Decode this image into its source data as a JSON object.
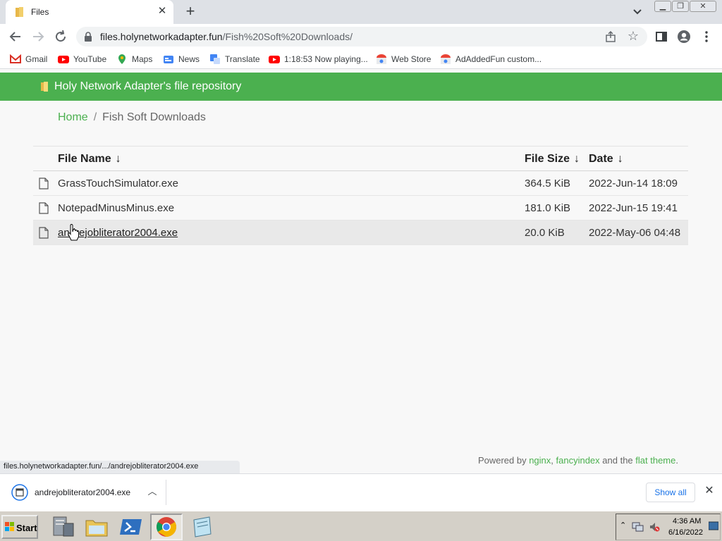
{
  "browser": {
    "tab": {
      "title": "Files"
    },
    "address": {
      "domain": "files.holynetworkadapter.fun",
      "path": "/Fish%20Soft%20Downloads/"
    },
    "bookmarks": [
      {
        "label": "Gmail",
        "icon": "gmail-icon"
      },
      {
        "label": "YouTube",
        "icon": "youtube-icon"
      },
      {
        "label": "Maps",
        "icon": "maps-icon"
      },
      {
        "label": "News",
        "icon": "news-icon"
      },
      {
        "label": "Translate",
        "icon": "translate-icon"
      },
      {
        "label": "1:18:53 Now playing...",
        "icon": "youtube-icon"
      },
      {
        "label": "Web Store",
        "icon": "webstore-icon"
      },
      {
        "label": "AdAddedFun custom...",
        "icon": "webstore-icon"
      }
    ],
    "status_url": "files.holynetworkadapter.fun/.../andrejobliterator2004.exe"
  },
  "site": {
    "header_title": "Holy Network Adapter's file repository",
    "breadcrumb": {
      "home": "Home",
      "sep": "/",
      "current": "Fish Soft Downloads"
    },
    "columns": {
      "name": "File Name",
      "size": "File Size",
      "date": "Date",
      "sort_arrow": "↓"
    },
    "files": [
      {
        "name": "GrassTouchSimulator.exe",
        "size": "364.5 KiB",
        "date": "2022-Jun-14 18:09"
      },
      {
        "name": "NotepadMinusMinus.exe",
        "size": "181.0 KiB",
        "date": "2022-Jun-15 19:41"
      },
      {
        "name": "andrejobliterator2004.exe",
        "size": "20.0 KiB",
        "date": "2022-May-06 04:48"
      }
    ],
    "footer": {
      "prefix": "Powered by ",
      "nginx": "nginx",
      "comma": ", ",
      "fancyindex": "fancyindex",
      "mid": " and the ",
      "flat": "flat theme",
      "end": "."
    }
  },
  "downloads": {
    "file": "andrejobliterator2004.exe",
    "show_all": "Show all"
  },
  "taskbar": {
    "start": "Start",
    "time": "4:36 AM",
    "date": "6/16/2022"
  },
  "colors": {
    "accent": "#4bb04f",
    "link": "#1a73e8"
  }
}
